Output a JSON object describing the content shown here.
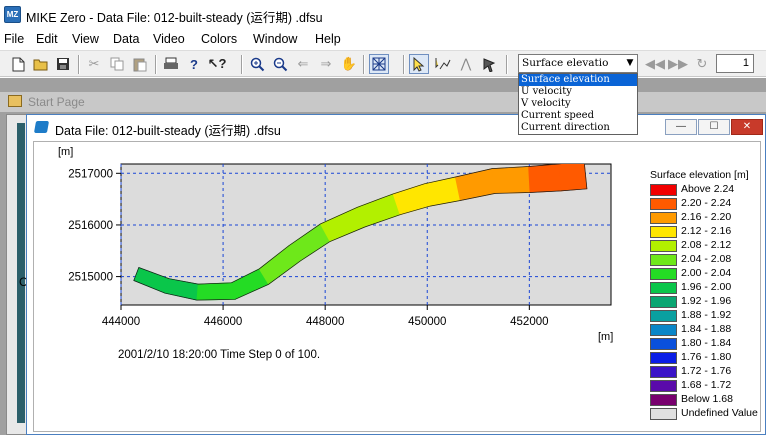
{
  "app": {
    "title": "MIKE Zero - Data File: 012-built-steady (运行期) .dfsu",
    "icon": "mike-zero-app-icon"
  },
  "menu": [
    "File",
    "Edit",
    "View",
    "Data",
    "Video",
    "Colors",
    "Window",
    "Help"
  ],
  "toolbar": {
    "item_select": {
      "value": "Surface elevatio",
      "options": [
        "Surface elevation",
        "U velocity",
        "V velocity",
        "Current speed",
        "Current direction"
      ],
      "selected_index": 0
    },
    "time_step_input": "1"
  },
  "start_page": {
    "label": "Start Page"
  },
  "document": {
    "title": "Data File: 012-built-steady (运行期) .dfsu",
    "timestamp_text": "2001/2/10 18:20:00  Time Step 0 of 100.",
    "y_unit": "[m]",
    "x_unit": "[m]"
  },
  "chart_data": {
    "type": "heatmap",
    "xlabel": "[m]",
    "ylabel": "[m]",
    "xlim": [
      444000,
      453600
    ],
    "ylim": [
      2514450,
      2517180
    ],
    "x_ticks": [
      444000,
      446000,
      448000,
      450000,
      452000
    ],
    "y_ticks": [
      2515000,
      2516000,
      2517000
    ],
    "x_tick_labels": [
      "444000",
      "446000",
      "448000",
      "450000",
      "452000"
    ],
    "y_tick_labels": [
      "2515000",
      "2516000",
      "2517000"
    ],
    "grid": true,
    "variable": "Surface elevation",
    "centerline": [
      {
        "x": 444300,
        "y": 2515050,
        "value": 1.94
      },
      {
        "x": 444900,
        "y": 2514820,
        "value": 1.99
      },
      {
        "x": 445500,
        "y": 2514700,
        "value": 2.01
      },
      {
        "x": 446200,
        "y": 2514720,
        "value": 2.03
      },
      {
        "x": 446800,
        "y": 2515000,
        "value": 2.05
      },
      {
        "x": 447400,
        "y": 2515450,
        "value": 2.07
      },
      {
        "x": 448000,
        "y": 2515850,
        "value": 2.09
      },
      {
        "x": 448700,
        "y": 2516150,
        "value": 2.11
      },
      {
        "x": 449400,
        "y": 2516400,
        "value": 2.13
      },
      {
        "x": 450000,
        "y": 2516580,
        "value": 2.15
      },
      {
        "x": 450600,
        "y": 2516700,
        "value": 2.17
      },
      {
        "x": 451300,
        "y": 2516850,
        "value": 2.19
      },
      {
        "x": 452000,
        "y": 2516880,
        "value": 2.21
      },
      {
        "x": 452600,
        "y": 2516920,
        "value": 2.23
      },
      {
        "x": 453100,
        "y": 2516970,
        "value": 2.25
      }
    ],
    "legend": {
      "title": "Surface elevation [m]",
      "placement": "right",
      "entries": [
        {
          "label": "Above 2.24",
          "color": "#f20000"
        },
        {
          "label": "2.20 - 2.24",
          "color": "#ff5a00"
        },
        {
          "label": "2.16 - 2.20",
          "color": "#ff9a00"
        },
        {
          "label": "2.12 - 2.16",
          "color": "#ffe600"
        },
        {
          "label": "2.08 - 2.12",
          "color": "#b2f000"
        },
        {
          "label": "2.04 - 2.08",
          "color": "#6ee81a"
        },
        {
          "label": "2.00 - 2.04",
          "color": "#24dc24"
        },
        {
          "label": "1.96 - 2.00",
          "color": "#0ac64a"
        },
        {
          "label": "1.92 - 1.96",
          "color": "#0aa672"
        },
        {
          "label": "1.88 - 1.92",
          "color": "#0aa0a0"
        },
        {
          "label": "1.84 - 1.88",
          "color": "#0a86c8"
        },
        {
          "label": "1.80 - 1.84",
          "color": "#0a50dc"
        },
        {
          "label": "1.76 - 1.80",
          "color": "#0a1ee6"
        },
        {
          "label": "1.72 - 1.76",
          "color": "#3a14c8"
        },
        {
          "label": "1.68 - 1.72",
          "color": "#5a0aaa"
        },
        {
          "label": "Below 1.68",
          "color": "#78006e"
        },
        {
          "label": "Undefined Value",
          "color": "#e0e0e0"
        }
      ]
    }
  }
}
